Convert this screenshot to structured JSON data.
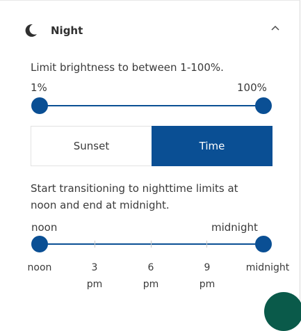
{
  "section": {
    "title": "Night",
    "moon_icon": "moon-icon",
    "collapse_icon": "chevron-up-icon"
  },
  "brightness": {
    "description": "Limit brightness to between 1-100%.",
    "min_label": "1%",
    "max_label": "100%",
    "range": [
      1,
      100
    ]
  },
  "mode": {
    "options": [
      "Sunset",
      "Time"
    ],
    "selected": "Time"
  },
  "schedule": {
    "description_line1": "Start transitioning to nighttime limits at",
    "description_line2": "noon and end at midnight.",
    "start_label": "noon",
    "end_label": "midnight",
    "ticks": [
      {
        "top": "noon",
        "bottom": ""
      },
      {
        "top": "3",
        "bottom": "pm"
      },
      {
        "top": "6",
        "bottom": "pm"
      },
      {
        "top": "9",
        "bottom": "pm"
      },
      {
        "top": "midnight",
        "bottom": ""
      }
    ]
  },
  "colors": {
    "accent": "#0a4f94",
    "text": "#3a3a3a"
  }
}
